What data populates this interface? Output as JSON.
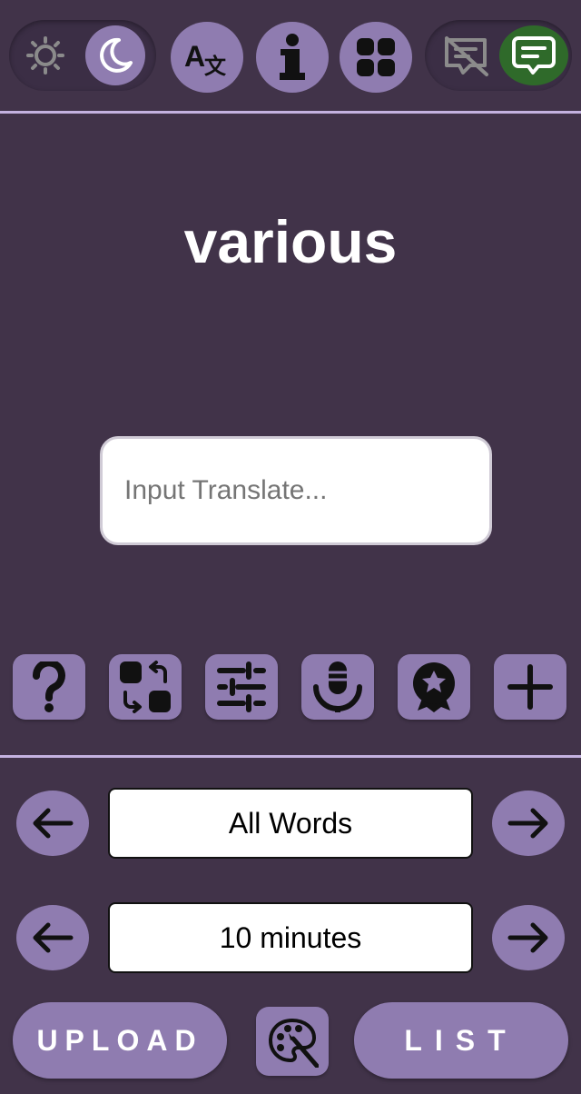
{
  "header": {
    "theme_toggle": {
      "light_icon": "sun-icon",
      "dark_icon": "moon-icon",
      "active": "dark"
    },
    "translate_icon": "translate-icon",
    "info_icon": "info-icon",
    "apps_icon": "apps-grid-icon",
    "comment_toggle": {
      "off_icon": "comment-off-icon",
      "on_icon": "comment-on-icon",
      "active": "on"
    }
  },
  "main": {
    "word": "various",
    "translate_input": {
      "value": "",
      "placeholder": "Input Translate..."
    }
  },
  "toolbar": {
    "icons": [
      "help-icon",
      "swap-icon",
      "settings-sliders-icon",
      "microphone-icon",
      "badge-icon",
      "add-icon"
    ]
  },
  "selectors": {
    "word_filter": {
      "value": "All Words"
    },
    "timer": {
      "value": "10 minutes"
    }
  },
  "footer": {
    "upload_label": "UPLOAD",
    "list_label": "LIST",
    "palette_icon": "palette-icon"
  },
  "colors": {
    "background": "#413349",
    "accent": "#8f7cb0",
    "divider": "#c4b2e0",
    "comment_active": "#2f6a2a"
  }
}
